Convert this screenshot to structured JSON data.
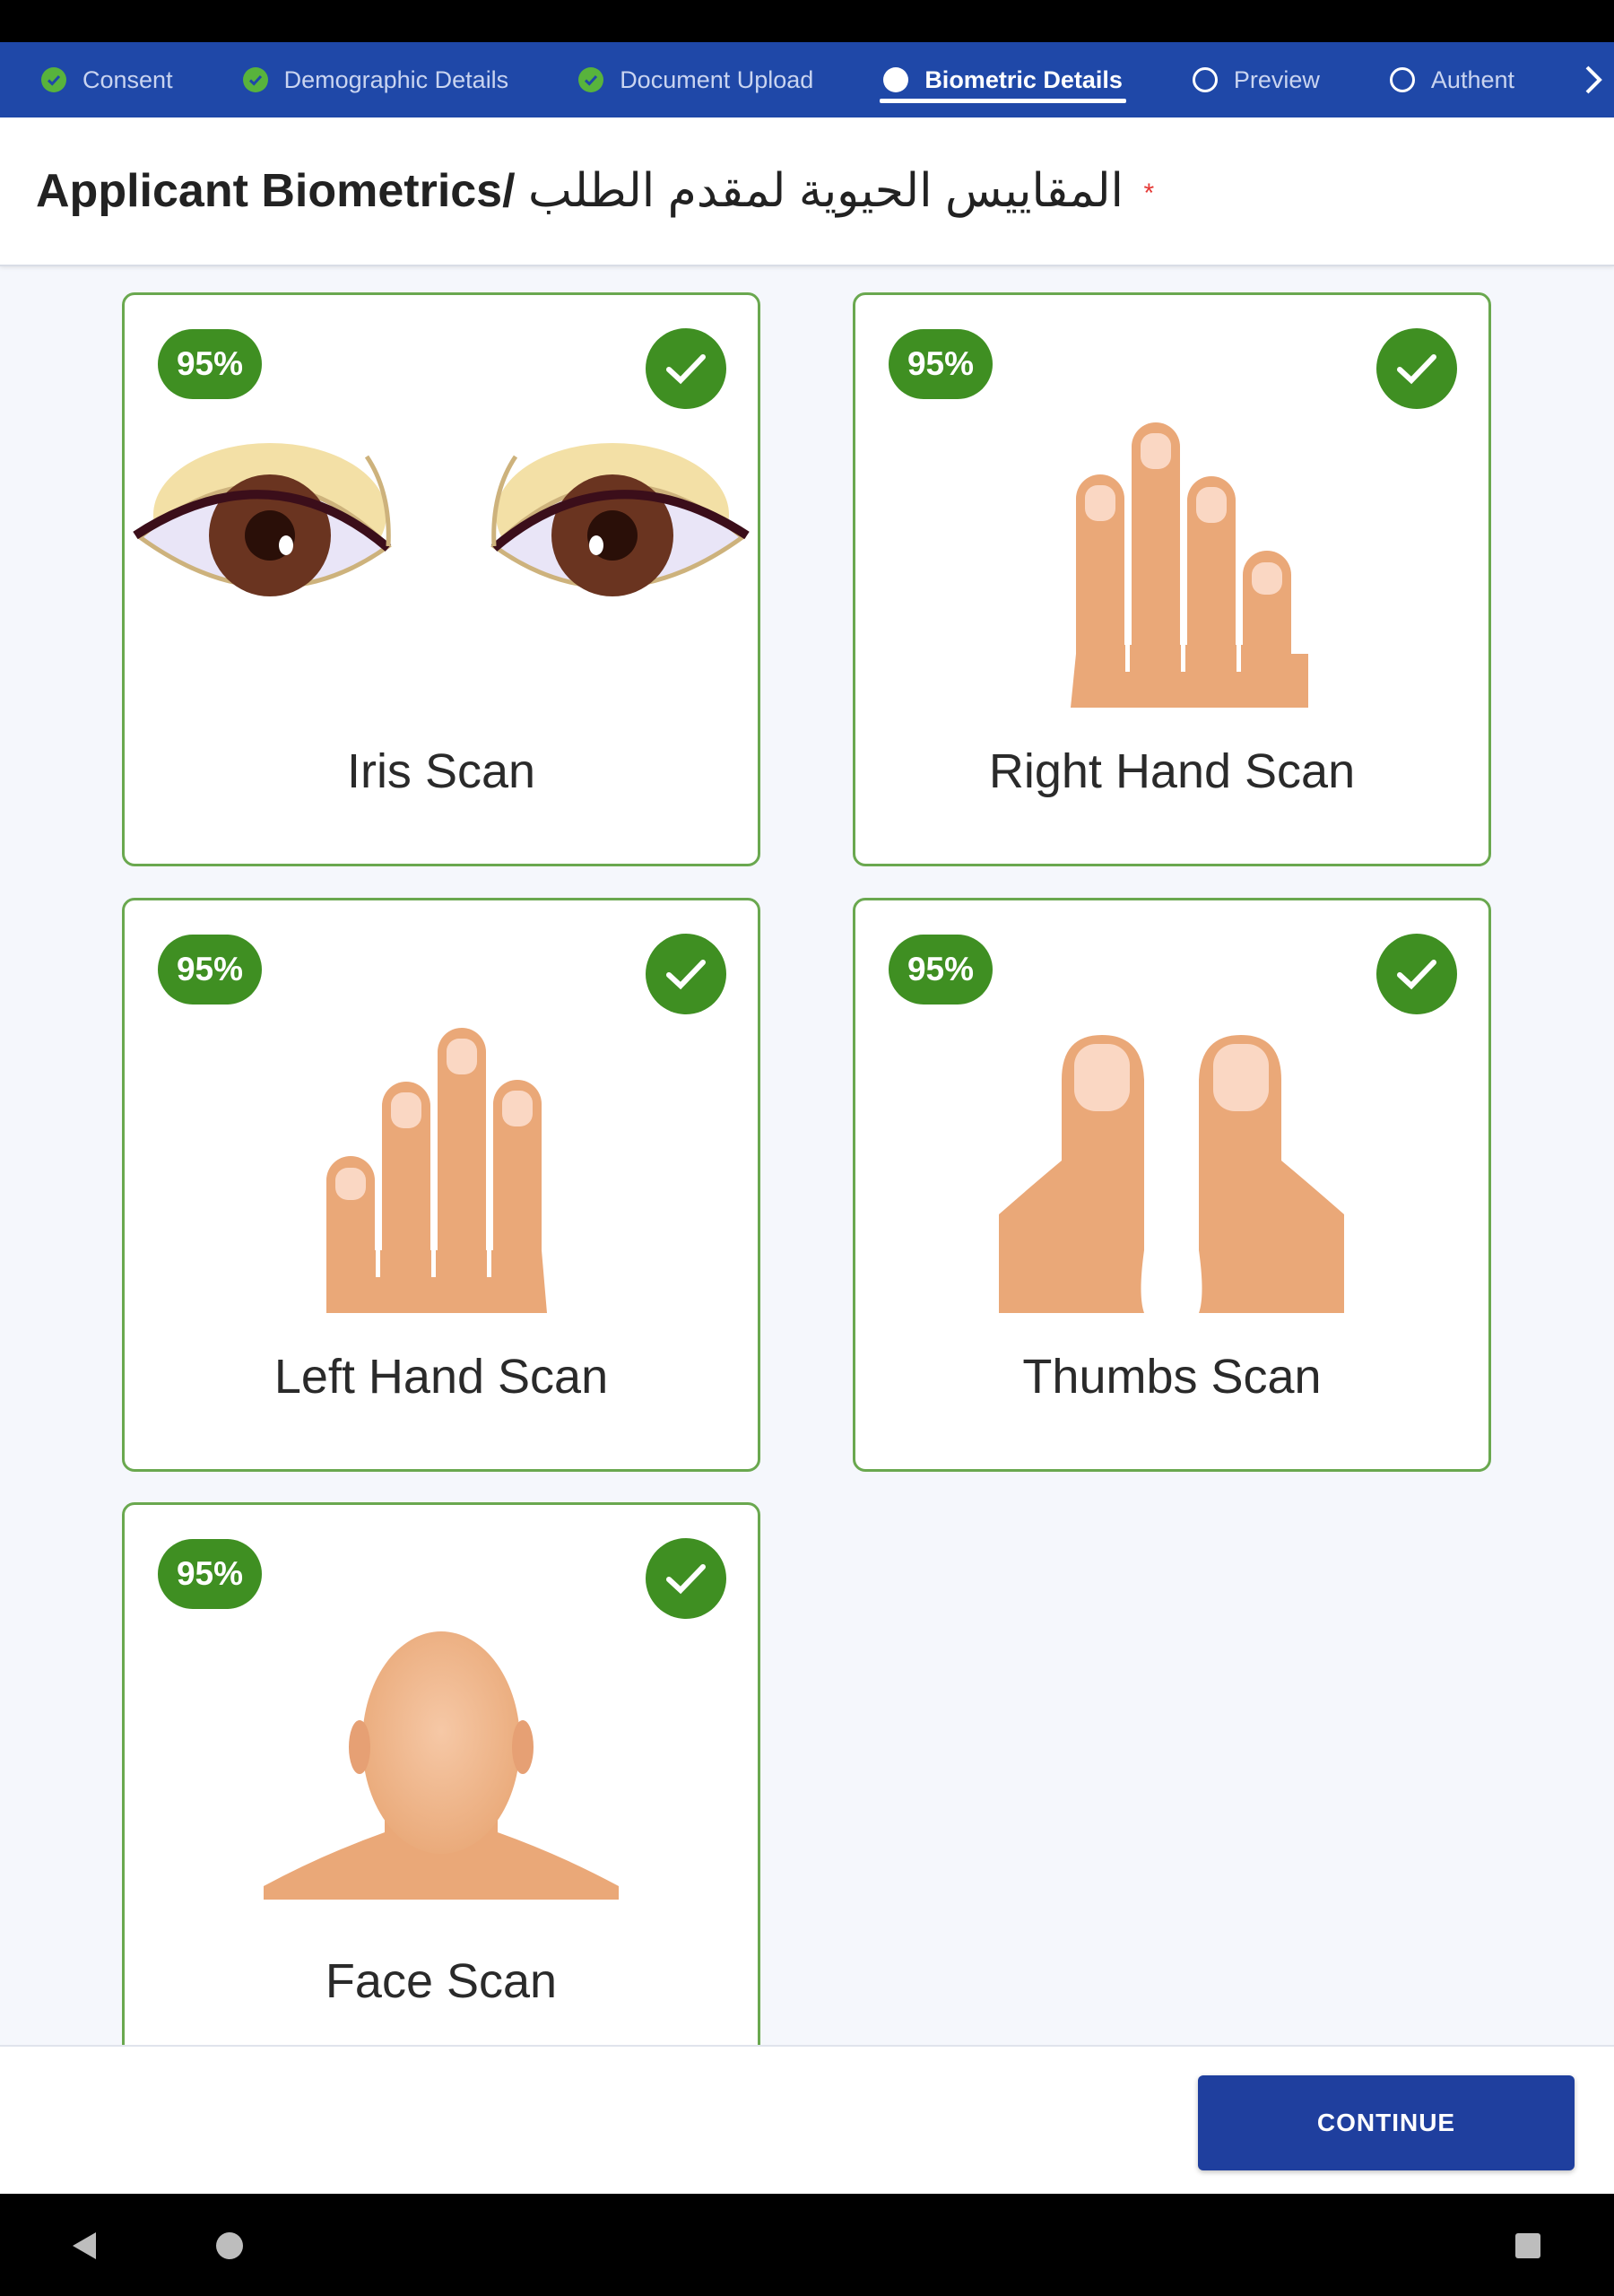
{
  "stepper": {
    "steps": [
      {
        "label": "Consent",
        "state": "done"
      },
      {
        "label": "Demographic Details",
        "state": "done"
      },
      {
        "label": "Document Upload",
        "state": "done"
      },
      {
        "label": "Biometric Details",
        "state": "active"
      },
      {
        "label": "Preview",
        "state": "todo"
      },
      {
        "label": "Authent",
        "state": "todo"
      }
    ],
    "scroll_icon": "chevron-right-icon"
  },
  "header": {
    "title_en": "Applicant Biometrics/",
    "title_ar": "المقاييس الحيوية لمقدم الطلب",
    "required_mark": "*"
  },
  "cards": [
    {
      "label": "Iris Scan",
      "quality": "95%",
      "status_icon": "check-icon",
      "art": "eyes-illustration"
    },
    {
      "label": "Right Hand Scan",
      "quality": "95%",
      "status_icon": "check-icon",
      "art": "right-hand-illustration"
    },
    {
      "label": "Left Hand Scan",
      "quality": "95%",
      "status_icon": "check-icon",
      "art": "left-hand-illustration"
    },
    {
      "label": "Thumbs Scan",
      "quality": "95%",
      "status_icon": "check-icon",
      "art": "thumbs-illustration"
    },
    {
      "label": "Face Scan",
      "quality": "95%",
      "status_icon": "check-icon",
      "art": "face-illustration"
    }
  ],
  "actions": {
    "continue_label": "CONTINUE"
  },
  "system_nav": {
    "back": "back-icon",
    "home": "home-icon",
    "recents": "recents-icon"
  },
  "colors": {
    "primary": "#1f48a8",
    "button": "#1f3f9e",
    "success": "#3f8f22",
    "card_border": "#6aa84f",
    "skin": "#eaa878"
  }
}
